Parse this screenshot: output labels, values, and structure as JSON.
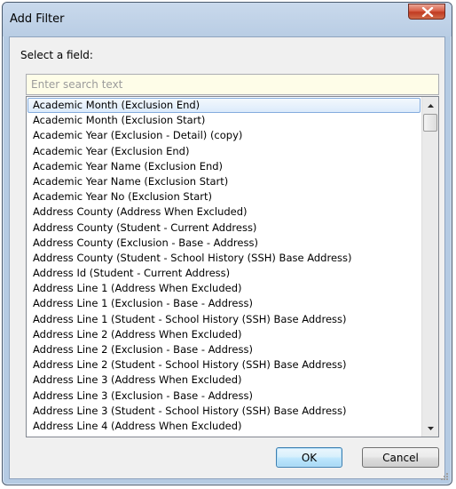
{
  "window": {
    "title": "Add Filter"
  },
  "field_label": "Select a field:",
  "search": {
    "value": "",
    "placeholder": "Enter search text"
  },
  "fields": [
    "Academic Month (Exclusion End)",
    "Academic Month (Exclusion Start)",
    "Academic Year (Exclusion - Detail) (copy)",
    "Academic Year (Exclusion End)",
    "Academic Year Name (Exclusion End)",
    "Academic Year Name (Exclusion Start)",
    "Academic Year No (Exclusion Start)",
    "Address County (Address When Excluded)",
    "Address County (Student - Current Address)",
    "Address County (Exclusion - Base - Address)",
    "Address County (Student - School History (SSH) Base Address)",
    "Address Id (Student - Current Address)",
    "Address Line 1 (Address When Excluded)",
    "Address Line 1 (Exclusion - Base - Address)",
    "Address Line 1 (Student - School History (SSH) Base Address)",
    "Address Line 2 (Address When Excluded)",
    "Address Line 2 (Exclusion - Base - Address)",
    "Address Line 2 (Student - School History (SSH) Base Address)",
    "Address Line 3 (Address When Excluded)",
    "Address Line 3 (Exclusion - Base - Address)",
    "Address Line 3 (Student - School History (SSH) Base Address)",
    "Address Line 4 (Address When Excluded)"
  ],
  "selected_index": 0,
  "buttons": {
    "ok": "OK",
    "cancel": "Cancel"
  },
  "icons": {
    "close": "close-icon",
    "scroll_up": "chevron-up-icon",
    "scroll_down": "chevron-down-icon",
    "resize": "resize-grip-icon"
  },
  "colors": {
    "search_bg": "#fefde8",
    "selection_border": "#84acdd",
    "close_button": "#c13b22",
    "default_button_border": "#3c7fb1"
  }
}
